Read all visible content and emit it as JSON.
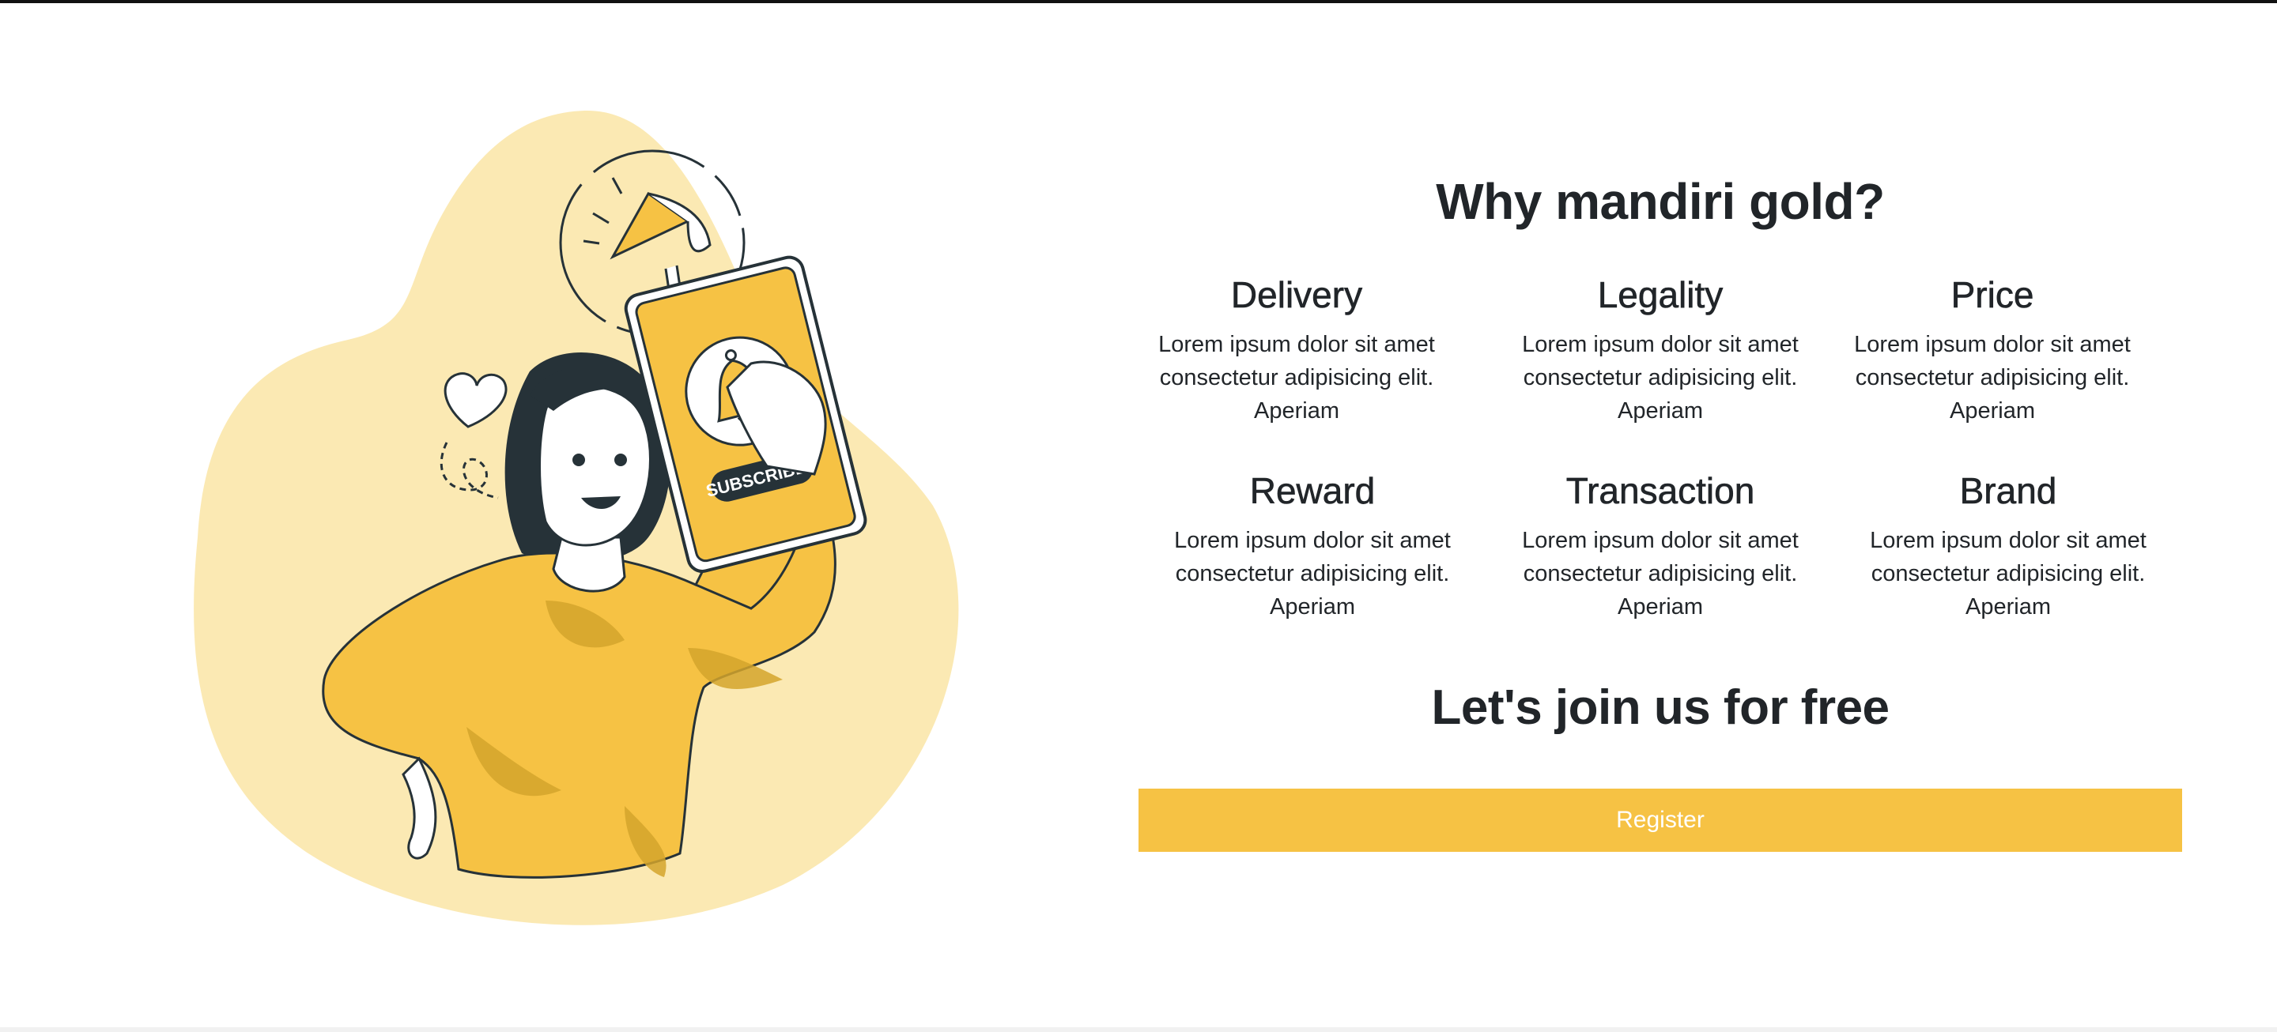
{
  "section": {
    "title": "Why mandiri gold?",
    "features": [
      {
        "title": "Delivery",
        "text": "Lorem ipsum dolor sit amet consectetur adipisicing elit. Aperiam"
      },
      {
        "title": "Legality",
        "text": "Lorem ipsum dolor sit amet consectetur adipisicing elit. Aperiam"
      },
      {
        "title": "Price",
        "text": "Lorem ipsum dolor sit amet consectetur adipisicing elit. Aperiam"
      },
      {
        "title": "Reward",
        "text": "Lorem ipsum dolor sit amet consectetur adipisicing elit. Aperiam"
      },
      {
        "title": "Transaction",
        "text": "Lorem ipsum dolor sit amet consectetur adipisicing elit. Aperiam"
      },
      {
        "title": "Brand",
        "text": "Lorem ipsum dolor sit amet consectetur adipisicing elit. Aperiam"
      }
    ],
    "cta_title": "Let's join us for free",
    "register_label": "Register"
  },
  "illustration": {
    "badge_text": "SUBSCRIBED",
    "icons": [
      "megaphone-icon",
      "heart-icon",
      "bell-icon"
    ]
  },
  "colors": {
    "accent": "#f6c244",
    "blob": "#fbe9b3",
    "shade": "#d4a42c",
    "ink": "#263238",
    "text": "#212529"
  }
}
